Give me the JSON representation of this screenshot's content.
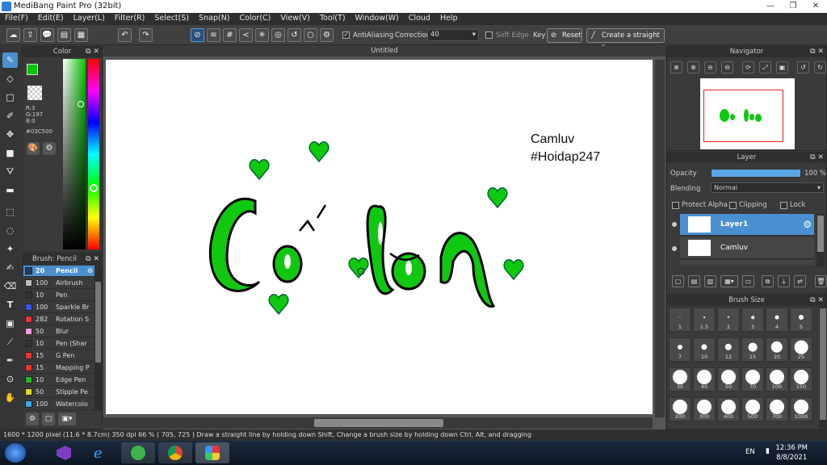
{
  "window": {
    "title": "MediBang Paint Pro (32bit)",
    "controls": [
      "—",
      "❐",
      "✕"
    ]
  },
  "menu": [
    "File(F)",
    "Edit(E)",
    "Layer(L)",
    "Filter(R)",
    "Select(S)",
    "Snap(N)",
    "Color(C)",
    "View(V)",
    "Tool(T)",
    "Window(W)",
    "Cloud",
    "Help"
  ],
  "toolbar": {
    "antialiasing_label": "AntiAliasing",
    "antialiasing_checked": true,
    "correction_label": "Correction",
    "correction_value": "40",
    "soft_edge_label": "Soft Edge",
    "key_label": "Key",
    "reset_label": "Reset",
    "straight_line_label": "Create a straight line"
  },
  "color_panel": {
    "title": "Color",
    "r": "R:3",
    "g": "G:197",
    "b": "B:0",
    "hex": "#03C500",
    "colors": {
      "foreground": "#03C500",
      "background": "#FFFFFF"
    }
  },
  "brush_panel": {
    "title": "Brush: Pencil",
    "items": [
      {
        "size": "20",
        "name": "Pencil",
        "color": "#2a3c5a",
        "selected": true
      },
      {
        "size": "100",
        "name": "Airbrush",
        "color": "#bbbbbb"
      },
      {
        "size": "10",
        "name": "Pen",
        "color": "#333333"
      },
      {
        "size": "100",
        "name": "Sparkle Br",
        "color": "#3355ee"
      },
      {
        "size": "282",
        "name": "Rotation S",
        "color": "#ee3333"
      },
      {
        "size": "50",
        "name": "Blur",
        "color": "#ff99dd"
      },
      {
        "size": "10",
        "name": "Pen (Shar",
        "color": "#333333"
      },
      {
        "size": "15",
        "name": "G Pen",
        "color": "#ee3333"
      },
      {
        "size": "15",
        "name": "Mapping P",
        "color": "#ee3333"
      },
      {
        "size": "10",
        "name": "Edge Pen",
        "color": "#22bb22"
      },
      {
        "size": "50",
        "name": "Stipple Pe",
        "color": "#dddd22"
      },
      {
        "size": "100",
        "name": "Watercolo",
        "color": "#33aaee"
      }
    ]
  },
  "canvas": {
    "tab_title": "Untitled",
    "text_line1": "Camluv",
    "text_line2": "#Hoidap247"
  },
  "navigator": {
    "title": "Navigator"
  },
  "layer_panel": {
    "title": "Layer",
    "opacity_label": "Opacity",
    "opacity_value": "100 %",
    "opacity_percent": 100,
    "blending_label": "Blending",
    "blending_value": "Normal",
    "protect_alpha": "Protect Alpha",
    "clipping": "Clipping",
    "lock": "Lock",
    "layers": [
      {
        "name": "Layer1",
        "selected": true
      },
      {
        "name": "Camluv",
        "selected": false
      }
    ]
  },
  "brush_size": {
    "title": "Brush Size",
    "sizes": [
      "1",
      "1.5",
      "2",
      "3",
      "4",
      "5",
      "7",
      "10",
      "12",
      "15",
      "20",
      "25",
      "30",
      "40",
      "50",
      "70",
      "100",
      "150",
      "200",
      "300",
      "400",
      "500",
      "700",
      "1000"
    ]
  },
  "status": {
    "text": "1600 * 1200 pixel   (11.6 * 8.7cm)   350 dpi   66 %   ( 705, 725 )   Draw a straight line by holding down Shift, Change a brush size by holding down Ctrl, Alt, and dragging"
  },
  "taskbar": {
    "lang": "EN",
    "time": "12:36 PM",
    "date": "8/8/2021"
  }
}
